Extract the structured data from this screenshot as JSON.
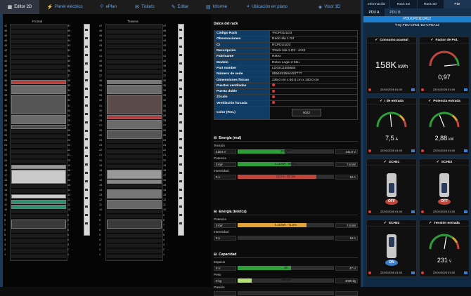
{
  "nav": {
    "tabs": [
      {
        "label": "Editor 2D",
        "icon": "▦"
      },
      {
        "label": "Panel eléctrico",
        "icon": "⚡"
      },
      {
        "label": "ePlan",
        "icon": "⟐"
      },
      {
        "label": "Tickets",
        "icon": "✉"
      },
      {
        "label": "Editar",
        "icon": "✎"
      },
      {
        "label": "Informe",
        "icon": "▤"
      },
      {
        "label": "Ubicación en plano",
        "icon": "⌖"
      },
      {
        "label": "Visor 3D",
        "icon": "◈"
      }
    ]
  },
  "racks": {
    "front_title": "Frontal",
    "rear_title": "Trasera",
    "units": [
      "47",
      "46",
      "45",
      "44",
      "43",
      "42",
      "41",
      "40",
      "39",
      "38",
      "37",
      "36",
      "35",
      "34",
      "33",
      "32",
      "31",
      "30",
      "29",
      "28",
      "27",
      "26",
      "25",
      "24",
      "23",
      "22",
      "21",
      "20",
      "19",
      "18",
      "17",
      "16",
      "15",
      "14",
      "13",
      "12",
      "11",
      "10",
      "9",
      "8",
      "7",
      "6",
      "5",
      "4",
      "3",
      "2",
      "1"
    ]
  },
  "details": {
    "title": "Datos del rack",
    "rows": [
      {
        "k": "Código Rack",
        "v": "*RCPD1I1D3"
      },
      {
        "k": "Observaciones",
        "v": "Rack Isla 1 D3"
      },
      {
        "k": "CI",
        "v": "RCPD1I1D3"
      },
      {
        "k": "Descripción",
        "v": "*Rack Isla 1 D3 - AIX2"
      },
      {
        "k": "Fabricante",
        "v": "Retex"
      },
      {
        "k": "Modelo",
        "v": "Retex Logic-2 56u"
      },
      {
        "k": "Part number",
        "v": "LOGIC2355564"
      },
      {
        "k": "Número de serie",
        "v": "8554453564457777"
      },
      {
        "k": "Dimensiones físicas",
        "v": "236.0 cm x 80.0 cm x 100.0 cm"
      },
      {
        "k": "Puertas ventiladas",
        "v": ""
      },
      {
        "k": "Puerta doble",
        "v": ""
      },
      {
        "k": "Zócalo",
        "v": ""
      },
      {
        "k": "Ventilación forzada",
        "v": ""
      }
    ],
    "color_label": "Color (RAL)",
    "color_value": "9022"
  },
  "energy_real": {
    "title": "Energía (real)",
    "rows": [
      {
        "label": "Tensión",
        "left": "218.5 V",
        "text": "229.4 V",
        "right": "241.5 V",
        "pct": 0.49,
        "color": "#2e9e3a"
      },
      {
        "label": "Potencia",
        "left": "0 kW",
        "text": "4.16 kW - 55.5%",
        "right": "7.5 kW",
        "pct": 0.555,
        "color": "#2e9e3a"
      },
      {
        "label": "Intensidad",
        "left": "0 A",
        "text": "13.2 A - 82.1%",
        "right": "16 A",
        "pct": 0.821,
        "color": "#c0463c"
      }
    ]
  },
  "energy_theo": {
    "title": "Energía (teórica)",
    "rows": [
      {
        "label": "Potencia",
        "left": "0 kW",
        "text": "5.33 kW - 71.5%",
        "right": "7.5 kW",
        "pct": 0.715,
        "color": "#e0a43a"
      },
      {
        "label": "Intensidad",
        "left": "0 A",
        "text": "",
        "right": "16 A",
        "pct": 0,
        "color": "#2e9e3a"
      }
    ]
  },
  "capacity": {
    "title": "Capacidad",
    "rows": [
      {
        "label": "Espacio",
        "left": "0 U",
        "text": "26",
        "right": "47 U",
        "pct": 0.553,
        "color": "#2e9e3a"
      },
      {
        "label": "Peso",
        "left": "0 kg",
        "text": "289.09",
        "right": "2000 kg",
        "pct": 0.145,
        "color": "#b8e07a"
      },
      {
        "label": "Presión",
        "left": "",
        "text": "",
        "right": "",
        "pct": 0,
        "color": "#2e9e3a"
      }
    ]
  },
  "right": {
    "tabs": [
      "Información",
      "Rack 3D",
      "Rack 2D",
      "PDI"
    ],
    "pdu_tabs": [
      "PDU A",
      "PDU B"
    ],
    "pdu_name": "PDUCPD1D3A12",
    "pdu_sub": "*HQ PDU-CPD1-D3-CPDA12",
    "cards": [
      {
        "title": "Consumo acumul",
        "value": "158K",
        "unit": "kWh",
        "date": "22/01/2026 01:00",
        "type": "text"
      },
      {
        "title": "Factor de Pot.",
        "value": "0,97",
        "date": "22/01/2026 01:00",
        "type": "gauge-pf",
        "pct": 0.97
      },
      {
        "title": "I de entrada",
        "value": "7,5",
        "unit": "A",
        "date": "22/01/2026 01:00",
        "type": "gauge",
        "pct": 0.47
      },
      {
        "title": "Potencia entrada",
        "value": "2,88",
        "unit": "kW",
        "date": "22/01/2026 01:00",
        "type": "gauge",
        "pct": 0.38
      },
      {
        "title": "SCH01",
        "state": "OFF",
        "date": "22/01/2026 01:00",
        "type": "switch"
      },
      {
        "title": "SCH02",
        "state": "OFF",
        "date": "22/01/2026 01:00",
        "type": "switch"
      },
      {
        "title": "SCH03",
        "state": "ON",
        "date": "22/01/2026 01:00",
        "type": "switch"
      },
      {
        "title": "Tensión entrada",
        "value": "231",
        "unit": "V",
        "date": "22/01/2026 01:00",
        "type": "gauge",
        "pct": 0.55
      }
    ]
  },
  "colors": {
    "accent": "#1d7fcf",
    "ok": "#2e9e3a",
    "warn": "#e0a43a",
    "danger": "#c0463c"
  }
}
